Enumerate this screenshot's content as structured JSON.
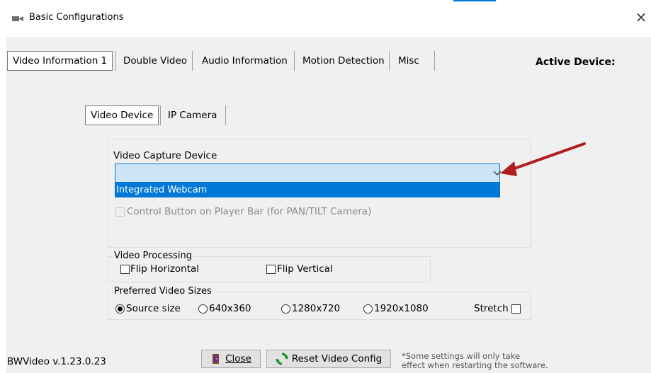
{
  "window": {
    "title": "Basic Configurations",
    "close_glyph": "×",
    "icon": "video-camera-icon"
  },
  "tabs": [
    {
      "label": "Video Information 1",
      "selected": true
    },
    {
      "label": "Double Video",
      "selected": false
    },
    {
      "label": "Audio Information",
      "selected": false
    },
    {
      "label": "Motion Detection",
      "selected": false
    },
    {
      "label": "Misc",
      "selected": false
    }
  ],
  "active_device_label": "Active Device:",
  "subtabs": [
    {
      "label": "Video Device",
      "selected": true
    },
    {
      "label": "IP Camera",
      "selected": false
    }
  ],
  "capture": {
    "label": "Video Capture Device",
    "value": "",
    "option": "Integrated Webcam",
    "control_button_label": "Control Button on Player Bar (for PAN/TILT Camera)",
    "control_button_checked": false
  },
  "processing": {
    "label": "Video Processing",
    "flip_horizontal": "Flip Horizontal",
    "flip_vertical": "Flip Vertical"
  },
  "sizes": {
    "label": "Preferred Video Sizes",
    "options": [
      "Source size",
      "640x360",
      "1280x720",
      "1920x1080"
    ],
    "selected": "Source size",
    "stretch_label": "Stretch"
  },
  "footer": {
    "version": "BWVideo v.1.23.0.23",
    "close_button": "Close",
    "close_button_icon": "door-exit-icon",
    "reset_button": "Reset Video Config",
    "reset_button_icon": "refresh-icon",
    "note_line1": "*Some settings will only take",
    "note_line2": "effect when restarting the software."
  },
  "colors": {
    "selection_blue": "#0078d7",
    "combo_bg": "#cce4f7",
    "annotation_arrow": "#b01e1e"
  }
}
